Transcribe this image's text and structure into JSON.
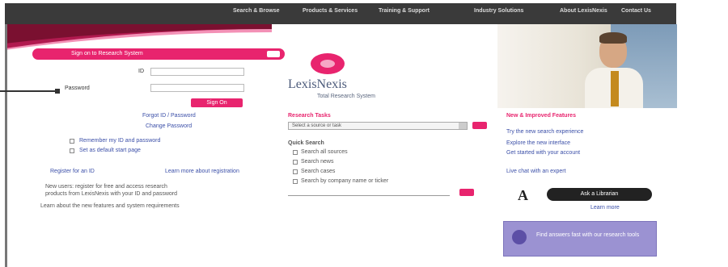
{
  "topnav": {
    "items": [
      {
        "label": "Search & Browse"
      },
      {
        "label": "Products & Services"
      },
      {
        "label": "Training & Support"
      },
      {
        "label": "Industry Solutions"
      },
      {
        "label": "About LexisNexis"
      },
      {
        "label": "Contact Us"
      }
    ]
  },
  "login": {
    "banner": "Sign on to Research System",
    "id_label": "ID",
    "password_label": "Password",
    "signin_label": "Sign On",
    "links": [
      "Forgot ID / Password",
      "Change Password"
    ],
    "options": [
      "Remember my ID and password",
      "Set as default start page"
    ],
    "bottom_links": [
      "Register for an ID",
      "Learn more about registration"
    ],
    "notice_lines": [
      "New users: register for free and access research",
      "products from LexisNexis with your ID and password",
      "Learn about the new features and system requirements"
    ]
  },
  "brand": {
    "name": "LexisNexis",
    "tagline": "Total Research System"
  },
  "research": {
    "title": "Research Tasks",
    "select_value": "Select a source or task",
    "search_title": "Quick Search",
    "search_options": [
      "Search all sources",
      "Search news",
      "Search cases",
      "Search by company name or ticker"
    ],
    "search_placeholder": ""
  },
  "sidebar": {
    "title": "New & Improved Features",
    "links": [
      "Try the new search experience",
      "Explore the new interface",
      "Get started with your account",
      "Live chat with an expert"
    ]
  },
  "badge": {
    "letter": "A",
    "label": "Ask a Librarian",
    "caption": "Learn more"
  },
  "promo": {
    "label": "Find answers fast with our research tools"
  }
}
